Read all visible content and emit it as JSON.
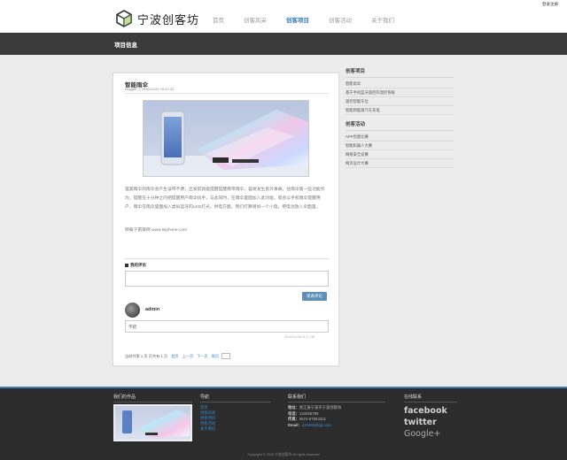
{
  "header": {
    "login_link": "登录注册",
    "logo_text": "宁波创客坊",
    "nav": [
      {
        "label": "首页",
        "active": false
      },
      {
        "label": "创客风采",
        "active": false
      },
      {
        "label": "创客项目",
        "active": true
      },
      {
        "label": "创客活动",
        "active": false
      },
      {
        "label": "关于我们",
        "active": false
      }
    ]
  },
  "page_title": "项目信息",
  "article": {
    "title": "智能雨伞",
    "author": "Maggie",
    "date": "2016/11/26 16:42:33",
    "body": "遗漏雨伞的雨伞会产生误带不便，出发前就能提醒提醒携带雨伞，容易发生意外事故，往雨伞第一些功能作为，提醒在十分钟之内把提醒用户雨伞找手，与此同时，在雨伞里面加入此功能，就会以手机雨伞提醒用户，雨伞在雨伞里面加入类似蓝牙的LED灯光，供电方面，我们打算增加一个小电，把电池放入伞面里。",
    "link_text": "转载于雷锋网 www.leiphone.com"
  },
  "comments": {
    "label": "我的评论",
    "submit_label": "发表评论",
    "items": [
      {
        "user": "admin",
        "text": "不错",
        "time": "2016/11/28 11:17:38"
      }
    ]
  },
  "pager": {
    "summary": "当前共第 1 页 页共有 1 页",
    "links": [
      "首页",
      "上一页",
      "下一页",
      "尾页"
    ]
  },
  "sidebar": {
    "projects_head": "创客项目",
    "projects": [
      "智能雨伞",
      "基于手机蓝牙遥控的温控系统",
      "遥控智能车位",
      "智能新能源汽车充电"
    ],
    "events_head": "创客活动",
    "events": [
      "APP创意比赛",
      "智能机器人大赛",
      "网络安全竞赛",
      "网页设计大赛"
    ]
  },
  "footer": {
    "works_head": "我们的作品",
    "nav_head": "导航",
    "nav_links": [
      "首页",
      "创客风采",
      "创客项目",
      "创客活动",
      "关于我们"
    ],
    "contact_head": "联系我们",
    "contact": [
      {
        "label": "地址：",
        "value": "浙江省宁波市宁波创客坊"
      },
      {
        "label": "电话：",
        "value": "123456789"
      },
      {
        "label": "传真：",
        "value": "0574-87654321"
      },
      {
        "label": "Email：",
        "value": "123456@qq.com"
      }
    ],
    "social_head": "在线联系",
    "social": [
      "facebook",
      "twitter",
      "Google+"
    ],
    "copyright": "Copyright © 2016 宁波创客坊 All rights reserved"
  },
  "colors": {
    "accent": "#3a7fb8",
    "title_bar": "#3b3b3b",
    "footer_bg": "#2c2c2c",
    "page_bg": "#ececec"
  }
}
